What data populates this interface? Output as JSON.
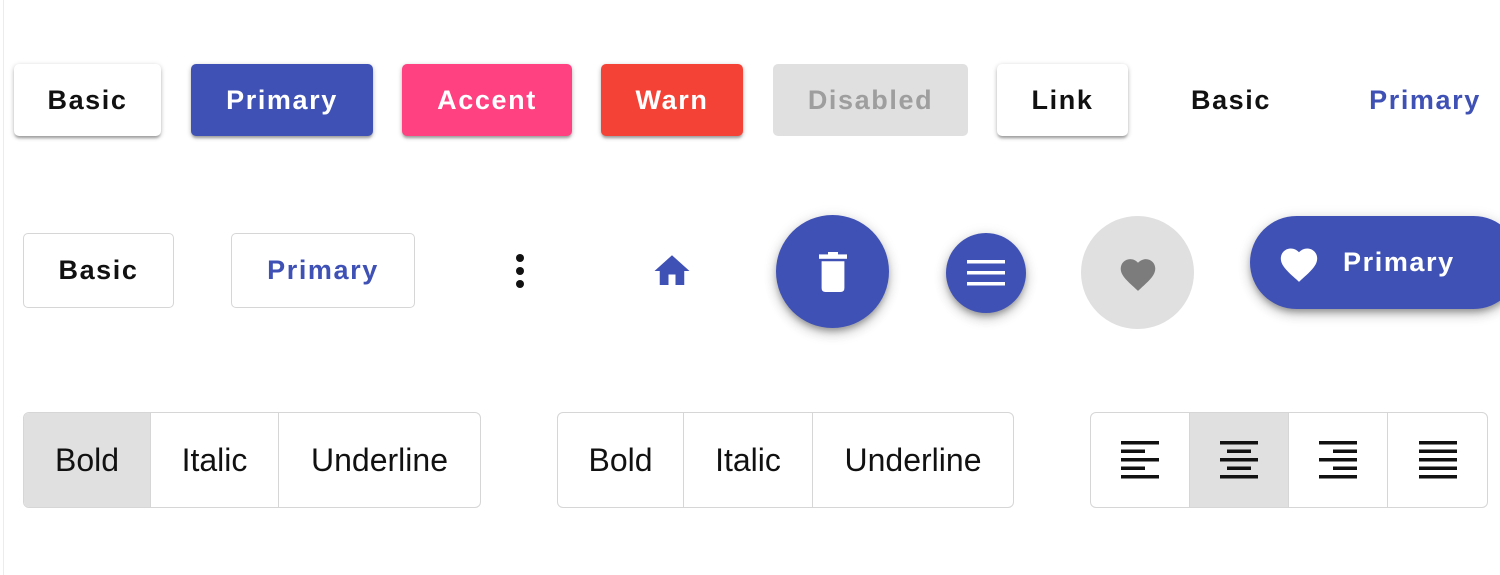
{
  "colors": {
    "primary": "#3f51b5",
    "accent": "#ff4081",
    "warn": "#f44336",
    "disabled_bg": "#e0e0e0",
    "disabled_text": "#9e9e9e",
    "text": "#111111"
  },
  "raised_row": {
    "basic_label": "Basic",
    "primary_label": "Primary",
    "accent_label": "Accent",
    "warn_label": "Warn",
    "disabled_label": "Disabled",
    "link_label": "Link"
  },
  "flat_row": {
    "basic_label": "Basic",
    "primary_label": "Primary"
  },
  "stroked_row": {
    "basic_label": "Basic",
    "primary_label": "Primary"
  },
  "icon_buttons": {
    "more": "more-vert-icon",
    "home": "home-icon",
    "delete": "delete-icon",
    "menu": "menu-icon",
    "favorite": "favorite-icon"
  },
  "extended_fab": {
    "icon": "favorite-icon",
    "label": "Primary"
  },
  "toggle_group_1": {
    "items": [
      {
        "label": "Bold",
        "checked": true
      },
      {
        "label": "Italic",
        "checked": false
      },
      {
        "label": "Underline",
        "checked": false
      }
    ]
  },
  "toggle_group_2": {
    "items": [
      {
        "label": "Bold",
        "checked": false
      },
      {
        "label": "Italic",
        "checked": false
      },
      {
        "label": "Underline",
        "checked": false
      }
    ]
  },
  "align_group": {
    "items": [
      {
        "icon": "format-align-left-icon",
        "checked": false
      },
      {
        "icon": "format-align-center-icon",
        "checked": true
      },
      {
        "icon": "format-align-right-icon",
        "checked": false
      },
      {
        "icon": "format-align-justify-icon",
        "checked": false
      }
    ]
  }
}
